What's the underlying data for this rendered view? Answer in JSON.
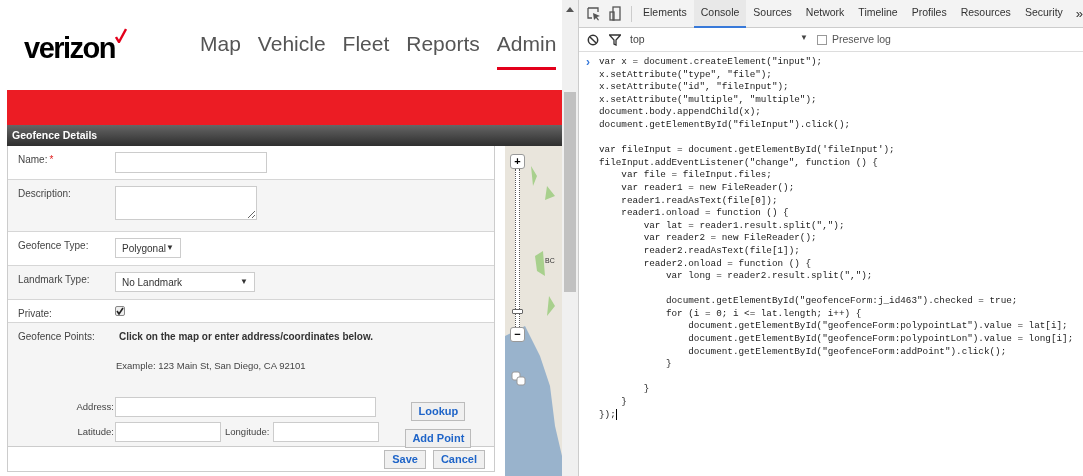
{
  "site": {
    "logo": "verizon",
    "nav": [
      {
        "label": "Map",
        "selected": false
      },
      {
        "label": "Vehicle",
        "selected": false
      },
      {
        "label": "Fleet",
        "selected": false
      },
      {
        "label": "Reports",
        "selected": false
      },
      {
        "label": "Admin",
        "selected": true
      }
    ]
  },
  "panel": {
    "title": "Geofence Details",
    "rows": [
      {
        "kind": "text",
        "label": "Name:",
        "required_mark": "*"
      },
      {
        "kind": "textarea",
        "label": "Description:"
      },
      {
        "kind": "select",
        "label": "Geofence Type:",
        "value": "Polygonal",
        "arrow": "▼"
      },
      {
        "kind": "select-wide",
        "label": "Landmark Type:",
        "value": "No Landmark",
        "arrow": "▼"
      },
      {
        "kind": "checkbox",
        "label": "Private:",
        "checked": true
      }
    ],
    "points": {
      "label": "Geofence Points:",
      "instruction": "Click on the map or enter address/coordinates below.",
      "example": "Example: 123 Main St, San Diego, CA 92101",
      "address_label": "Address:",
      "latitude_label": "Latitude:",
      "longitude_label": "Longitude:",
      "lookup_button": "Lookup",
      "add_point_button": "Add Point"
    },
    "buttons": [
      "Save",
      "Cancel"
    ],
    "map": {
      "label": "BC",
      "zoom_in": "+",
      "zoom_out": "−",
      "zoom": {
        "level": 0.08
      }
    }
  },
  "devtools": {
    "tabs": [
      {
        "label": "Elements",
        "selected": false
      },
      {
        "label": "Console",
        "selected": true
      },
      {
        "label": "Sources",
        "selected": false
      },
      {
        "label": "Network",
        "selected": false
      },
      {
        "label": "Timeline",
        "selected": false
      },
      {
        "label": "Profiles",
        "selected": false
      },
      {
        "label": "Resources",
        "selected": false
      },
      {
        "label": "Security",
        "selected": false
      }
    ],
    "more": "»",
    "context": "top",
    "context_arrow": "▼",
    "preserve_log": {
      "label": "Preserve log",
      "checked": false
    },
    "prompt": "›",
    "code_blocks": [
      [
        "var x = document.createElement(\"input\");",
        "x.setAttribute(\"type\", \"file\");",
        "x.setAttribute(\"id\", \"fileInput\");",
        "x.setAttribute(\"multiple\", \"multiple\");",
        "document.body.appendChild(x);",
        "document.getElementById(\"fileInput\").click();"
      ],
      [
        "var fileInput = document.getElementById('fileInput');",
        "fileInput.addEventListener(\"change\", function () {",
        "    var file = fileInput.files;",
        "    var reader1 = new FileReader();",
        "    reader1.readAsText(file[0]);",
        "    reader1.onload = function () {",
        "        var lat = reader1.result.split(\",\");",
        "        var reader2 = new FileReader();",
        "        reader2.readAsText(file[1]);",
        "        reader2.onload = function () {",
        "            var long = reader2.result.split(\",\");"
      ],
      [
        "            document.getElementById(\"geofenceForm:j_id463\").checked = true;",
        "            for (i = 0; i <= lat.length; i++) {",
        "                document.getElementById(\"geofenceForm:polypointLat\").value = lat[i];",
        "                document.getElementById(\"geofenceForm:polypointLon\").value = long[i];",
        "                document.getElementById(\"geofenceForm:addPoint\").click();",
        "            }"
      ],
      [
        "        }",
        "    }",
        "});"
      ]
    ]
  }
}
